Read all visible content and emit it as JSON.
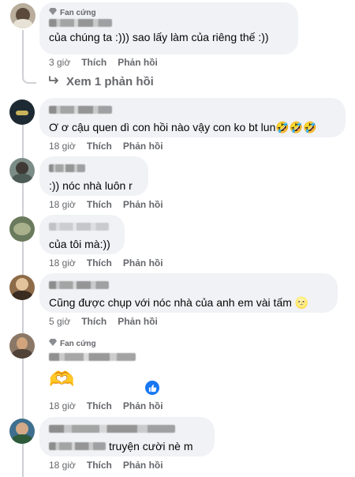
{
  "comments": [
    {
      "badge": "Fan cứng",
      "text": "của chúng ta :))) sao lấy làm của riêng thế :))",
      "time": "3 giờ",
      "like": "Thích",
      "reply": "Phản hồi",
      "avatar_color": "#b9ad9c"
    },
    {
      "text": "Ơ ơ cậu quen dì con hồi nào vậy con ko bt lun🤣🤣🤣",
      "time": "18 giờ",
      "like": "Thích",
      "reply": "Phản hồi",
      "avatar_color": "#1d2a33"
    },
    {
      "text": ":)) nóc nhà luôn r",
      "time": "18 giờ",
      "like": "Thích",
      "reply": "Phản hồi",
      "avatar_color": "#7c8c86"
    },
    {
      "text": "của tôi mà:))",
      "time": "18 giờ",
      "like": "Thích",
      "reply": "Phản hồi",
      "avatar_color": "#6a7a5c"
    },
    {
      "text": "Cũng được chụp với nóc nhà của anh em vài tấm 🌝",
      "time": "5 giờ",
      "like": "Thích",
      "reply": "Phản hồi",
      "avatar_color": "#8e6b48"
    },
    {
      "badge": "Fan cứng",
      "sticker": "🫶",
      "time": "18 giờ",
      "like": "Thích",
      "reply": "Phản hồi",
      "reaction": "like",
      "avatar_color": "#8a7766"
    },
    {
      "text": "truyện cười nè m",
      "time": "18 giờ",
      "like": "Thích",
      "reply": "Phản hồi",
      "avatar_color": "#3e6f8f"
    }
  ],
  "view_replies": "Xem 1 phản hồi",
  "colors": {
    "bubble": "#f0f2f5",
    "meta": "#65676b",
    "like_blue": "#1877f2",
    "thread_line": "#ced0d4"
  }
}
